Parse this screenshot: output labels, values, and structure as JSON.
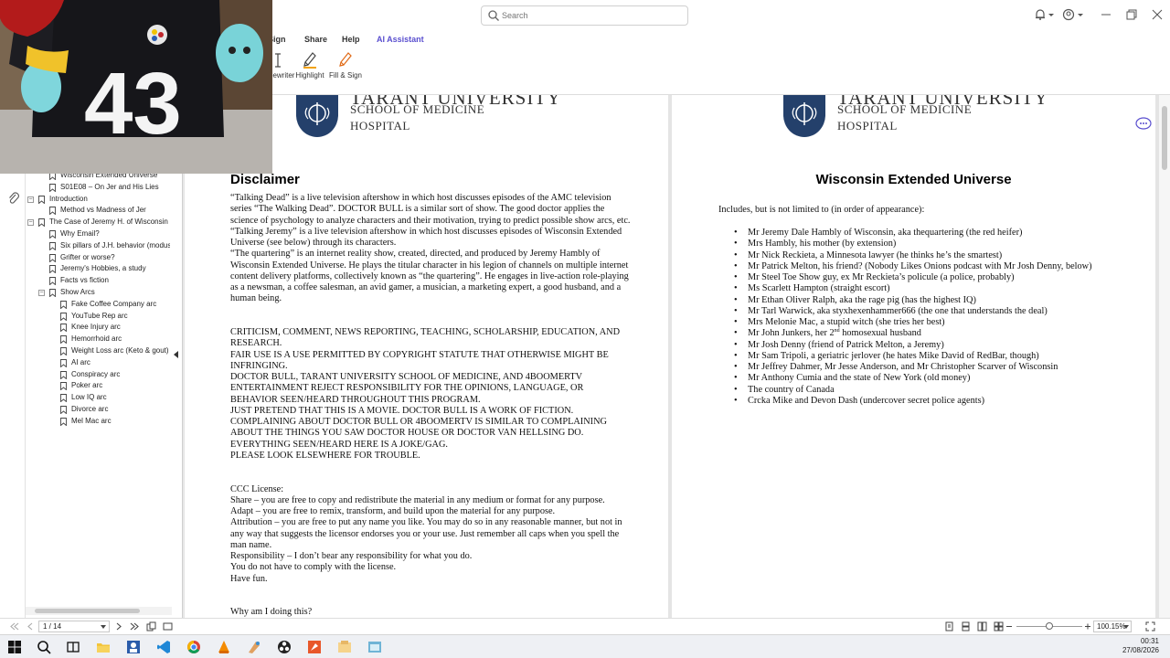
{
  "search": {
    "placeholder": "Search"
  },
  "menu": {
    "sign": "Sign",
    "share": "Share",
    "help": "Help",
    "ai": "AI Assistant"
  },
  "ribbon": {
    "typewriter": "Typewriter",
    "highlight": "Highlight",
    "fill_sign": "Fill & Sign"
  },
  "outline": [
    {
      "label": "Wisconsin Extended Universe",
      "level": 1,
      "toggle": ""
    },
    {
      "label": "S01E08 – On Jer and His Lies",
      "level": 1,
      "toggle": ""
    },
    {
      "label": "Introduction",
      "level": 0,
      "toggle": "−"
    },
    {
      "label": "Method vs Madness of Jer",
      "level": 1,
      "toggle": ""
    },
    {
      "label": "The Case of Jeremy H. of Wisconsin",
      "level": 0,
      "toggle": "−"
    },
    {
      "label": "Why Email?",
      "level": 1,
      "toggle": ""
    },
    {
      "label": "Six pillars of J.H. behavior (modus operandi)",
      "level": 1,
      "toggle": ""
    },
    {
      "label": "Grifter or worse?",
      "level": 1,
      "toggle": ""
    },
    {
      "label": "Jeremy's Hobbies, a study",
      "level": 1,
      "toggle": ""
    },
    {
      "label": "Facts vs fiction",
      "level": 1,
      "toggle": ""
    },
    {
      "label": "Show Arcs",
      "level": 1,
      "toggle": "−"
    },
    {
      "label": "Fake Coffee Company arc",
      "level": 2,
      "toggle": ""
    },
    {
      "label": "YouTube Rep arc",
      "level": 2,
      "toggle": ""
    },
    {
      "label": "Knee Injury arc",
      "level": 2,
      "toggle": ""
    },
    {
      "label": "Hemorrhoid arc",
      "level": 2,
      "toggle": ""
    },
    {
      "label": "Weight Loss arc (Keto & gout)",
      "level": 2,
      "toggle": ""
    },
    {
      "label": "AI arc",
      "level": 2,
      "toggle": ""
    },
    {
      "label": "Conspiracy arc",
      "level": 2,
      "toggle": ""
    },
    {
      "label": "Poker arc",
      "level": 2,
      "toggle": ""
    },
    {
      "label": "Low IQ arc",
      "level": 2,
      "toggle": ""
    },
    {
      "label": "Divorce arc",
      "level": 2,
      "toggle": ""
    },
    {
      "label": "Mel Mac arc",
      "level": 2,
      "toggle": ""
    }
  ],
  "letterhead": {
    "university": "TARANT UNIVERSITY",
    "school": "SCHOOL OF MEDICINE",
    "hospital": "HOSPITAL"
  },
  "page1": {
    "title": "Disclaimer",
    "paragraphs": [
      "“Talking Dead” is a live television aftershow in which host discusses episodes of the AMC television series “The Walking Dead”. DOCTOR BULL is a similar sort of show. The good doctor applies the science of psychology to analyze characters and their motivation, trying to predict possible show arcs, etc.",
      "“Talking Jeremy” is a live television aftershow in which host discusses episodes of Wisconsin Extended Universe (see below) through its characters.",
      "“The quartering” is an internet reality show, created, directed, and produced by Jeremy Hambly of Wisconsin Extended Universe. He plays the titular character in his legion of channels on multiple internet content delivery platforms, collectively known as “the quartering”. He engages in live-action role-playing as a newsman, a coffee salesman, an avid gamer, a musician, a marketing expert, a good husband, and a human being.",
      "",
      "CRITICISM, COMMENT, NEWS REPORTING, TEACHING, SCHOLARSHIP, EDUCATION, AND RESEARCH.",
      "FAIR USE IS A USE PERMITTED BY COPYRIGHT STATUTE THAT OTHERWISE MIGHT BE INFRINGING.",
      "DOCTOR BULL, TARANT UNIVERSITY SCHOOL OF MEDICINE, AND 4BOOMERTV ENTERTAINMENT REJECT RESPONSIBILITY FOR THE OPINIONS, LANGUAGE, OR BEHAVIOR SEEN/HEARD THROUGHOUT THIS PROGRAM.",
      "JUST PRETEND THAT THIS IS A MOVIE. DOCTOR BULL IS A WORK OF FICTION. COMPLAINING ABOUT DOCTOR BULL OR 4BOOMERTV IS SIMILAR TO COMPLAINING ABOUT THE THINGS YOU SAW DOCTOR HOUSE OR DOCTOR VAN HELLSING DO.",
      "EVERYTHING SEEN/HEARD HERE IS A JOKE/GAG.",
      "PLEASE LOOK ELSEWHERE FOR TROUBLE.",
      "",
      "CCC License:",
      "Share – you are free to copy and redistribute the material in any medium or format for any purpose.",
      "Adapt – you are free to remix, transform, and build upon the material for any purpose.",
      "Attribution – you are free to put any name you like. You may do so in any reasonable manner, but not in any way that suggests the licensor endorses you or your use. Just remember all caps when you spell the man name.",
      "Responsibility – I don’t bear any responsibility for what you do.",
      "You do not have to comply with the license.",
      "Have fun.",
      "",
      "Why am I doing this?"
    ]
  },
  "page2": {
    "title": "Wisconsin Extended Universe",
    "intro": "Includes, but is not limited to (in order of appearance):",
    "items": [
      "Mr Jeremy Dale Hambly of Wisconsin, aka thequartering (the red heifer)",
      "Mrs Hambly, his mother (by extension)",
      "Mr Nick Reckieta, a Minnesota lawyer (he thinks he’s the smartest)",
      "Mr Patrick Melton, his friend? (Nobody Likes Onions podcast with Mr Josh Denny, below)",
      "Mr Steel Toe Show guy, ex Mr Reckieta’s policule (a police, probably)",
      "Ms Scarlett Hampton (straight escort)",
      "Mr Ethan Oliver Ralph, aka the rage pig (has the highest IQ)",
      "Mr Tarl Warwick, aka styxhexenhammer666 (the one that understands the deal)",
      "Mrs Melonie Mac, a stupid witch (she tries her best)",
      "Mr John Junkers, her 2nd homosexual husband",
      "Mr Josh Denny (friend of Patrick Melton, a Jeremy)",
      "Mr Sam Tripoli, a geriatric jerlover (he hates Mike David of RedBar, though)",
      "Mr Jeffrey Dahmer, Mr Jesse Anderson, and Mr Christopher Scarver of Wisconsin",
      "Mr Anthony Cumia and the state of New York (old money)",
      "The country of Canada",
      "Crcka Mike and Devon Dash (undercover secret police agents)"
    ]
  },
  "webcam": {
    "jersey_number": "43"
  },
  "status": {
    "page_indicator": "1 / 14",
    "zoom": "100.15%"
  },
  "clock": {
    "time": "00:31",
    "date": "27/08/2026"
  },
  "colors": {
    "ai_accent": "#5a4fcf",
    "logo_blue": "#24406b"
  }
}
